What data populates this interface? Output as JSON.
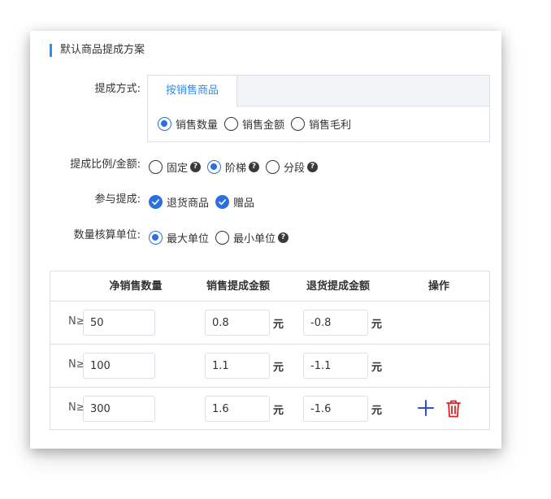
{
  "section": {
    "title": "默认商品提成方案"
  },
  "method": {
    "label": "提成方式:",
    "tab": "按销售商品",
    "options": [
      {
        "label": "销售数量",
        "selected": true
      },
      {
        "label": "销售金额",
        "selected": false
      },
      {
        "label": "销售毛利",
        "selected": false
      }
    ]
  },
  "ratio": {
    "label": "提成比例/金额:",
    "options": [
      {
        "label": "固定",
        "selected": false,
        "help": true
      },
      {
        "label": "阶梯",
        "selected": true,
        "help": true
      },
      {
        "label": "分段",
        "selected": false,
        "help": true
      }
    ]
  },
  "participate": {
    "label": "参与提成:",
    "options": [
      {
        "label": "退货商品",
        "checked": true
      },
      {
        "label": "赠品",
        "checked": true
      }
    ]
  },
  "unit_calc": {
    "label": "数量核算单位:",
    "options": [
      {
        "label": "最大单位",
        "selected": true
      },
      {
        "label": "最小单位",
        "selected": false,
        "help": true
      }
    ]
  },
  "table": {
    "headers": [
      "净销售数量",
      "销售提成金额",
      "退货提成金额",
      "操作"
    ],
    "prefix": "N≥",
    "unit": "元",
    "rows": [
      {
        "qty": "50",
        "sale": "0.8",
        "return": "-0.8"
      },
      {
        "qty": "100",
        "sale": "1.1",
        "return": "-1.1"
      },
      {
        "qty": "300",
        "sale": "1.6",
        "return": "-1.6"
      }
    ]
  },
  "colors": {
    "accent": "#2b8ef0",
    "radio": "#2b6fe0",
    "add": "#2b4fe0",
    "delete": "#e02020"
  },
  "icons": {
    "help": "?",
    "add": "plus-icon",
    "delete": "trash-icon"
  }
}
